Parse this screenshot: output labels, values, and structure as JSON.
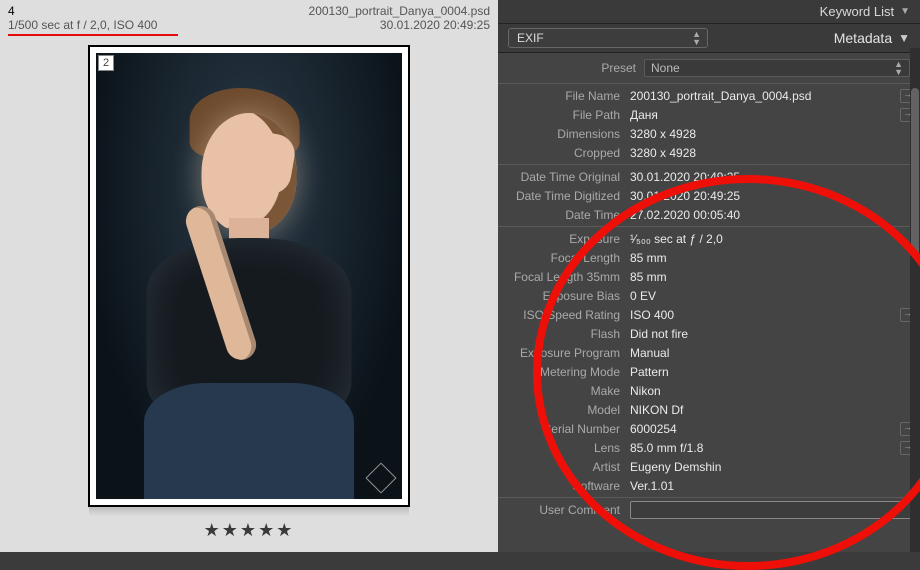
{
  "preview": {
    "index": "4",
    "filename": "200130_portrait_Danya_0004.psd",
    "exif_summary": "1/500 sec at f / 2,0, ISO 400",
    "datetime": "30.01.2020 20:49:25",
    "flag": "2",
    "rating": "★★★★★"
  },
  "panels": {
    "keyword_list": "Keyword List",
    "metadata": "Metadata"
  },
  "metadata_selector": {
    "value": "EXIF"
  },
  "preset": {
    "label": "Preset",
    "value": "None"
  },
  "file": {
    "rows": [
      {
        "label": "File Name",
        "value": "200130_portrait_Danya_0004.psd",
        "goto": true
      },
      {
        "label": "File Path",
        "value": "Даня",
        "goto": true
      },
      {
        "label": "Dimensions",
        "value": "3280 x 4928"
      },
      {
        "label": "Cropped",
        "value": "3280 x 4928"
      }
    ]
  },
  "dates": {
    "rows": [
      {
        "label": "Date Time Original",
        "value": "30.01.2020 20:49:25"
      },
      {
        "label": "Date Time Digitized",
        "value": "30.01.2020 20:49:25"
      },
      {
        "label": "Date Time",
        "value": "27.02.2020 00:05:40"
      }
    ]
  },
  "camera": {
    "rows": [
      {
        "label": "Exposure",
        "value": "¹⁄₅₀₀ sec at ƒ / 2,0"
      },
      {
        "label": "Focal Length",
        "value": "85 mm"
      },
      {
        "label": "Focal Length 35mm",
        "value": "85 mm"
      },
      {
        "label": "Exposure Bias",
        "value": "0 EV"
      },
      {
        "label": "ISO Speed Rating",
        "value": "ISO 400",
        "goto": true
      },
      {
        "label": "Flash",
        "value": "Did not fire"
      },
      {
        "label": "Exposure Program",
        "value": "Manual"
      },
      {
        "label": "Metering Mode",
        "value": "Pattern"
      },
      {
        "label": "Make",
        "value": "Nikon"
      },
      {
        "label": "Model",
        "value": "NIKON Df"
      },
      {
        "label": "Serial Number",
        "value": "6000254",
        "goto": true
      },
      {
        "label": "Lens",
        "value": "85.0 mm f/1.8",
        "goto": true
      },
      {
        "label": "Artist",
        "value": "Eugeny Demshin"
      },
      {
        "label": "Software",
        "value": "Ver.1.01"
      }
    ]
  },
  "user_comment": {
    "label": "User Comment"
  }
}
